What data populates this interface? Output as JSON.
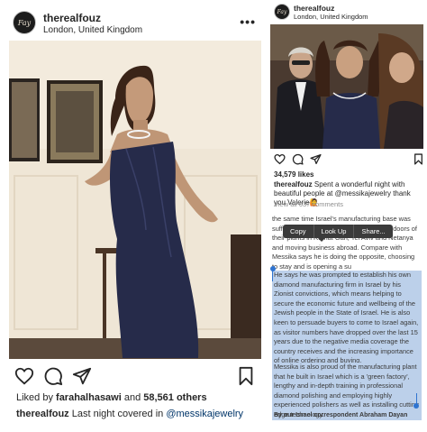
{
  "left_post": {
    "username": "therealfouz",
    "location": "London, United Kingdom",
    "more_label": "•••",
    "liked_prefix": "Liked by ",
    "liked_user": "farahalhasawi",
    "liked_middle": " and ",
    "liked_count": "58,561 others",
    "caption_user": "therealfouz",
    "caption_text": " Last night covered in ",
    "caption_mention": "@messikajewelry"
  },
  "right_post": {
    "username": "therealfouz",
    "location": "London, United Kingdom",
    "likes": "34,579 likes",
    "caption_user": "therealfouz",
    "caption_text": " Spent a wonderful night with beautiful people at @messikajewelry thank you Valerie",
    "caption_emoji": "🙋",
    "view_comments": "View all 637 comments"
  },
  "article": {
    "top_text": "the same time Israel's manufacturing base was suffering, with manufacturers closing the doors of their plants in Ramat Gan, Tel Aviv and Netanya and moving business abroad. Compare with Messika says he is doing the opposite, choosing to stay and is opening a su",
    "highlight_1": "He says he was prompted to establish his own diamond manufacturing firm in Israel by his Zionist convictions, which means helping to secure the economic future and wellbeing of the Jewish people in the State of Israel. He is also keen to persuade buyers to come to Israel again, as visitor numbers have dropped over the last 15 years due to the negative media coverage the country receives and the increasing importance of online ordering and buying.",
    "highlight_2": "Messika is also proud of the manufacturing plant that he built in Israel which is a 'green factory', lengthy and in-depth training in professional diamond polishing and employing highly experienced polishers as well as installing cutting edge technology.",
    "signature": "By our Israel correspondent Abraham Dayan"
  },
  "context_menu": {
    "items": [
      "Copy",
      "Look Up",
      "Share..."
    ]
  },
  "avatar_monogram": "Fay",
  "colors": {
    "link": "#003569",
    "selection": "#bcd0ea",
    "selection_handle": "#2f74d0",
    "menu_bg": "#3b3b3b",
    "dress": "#262b4a"
  }
}
